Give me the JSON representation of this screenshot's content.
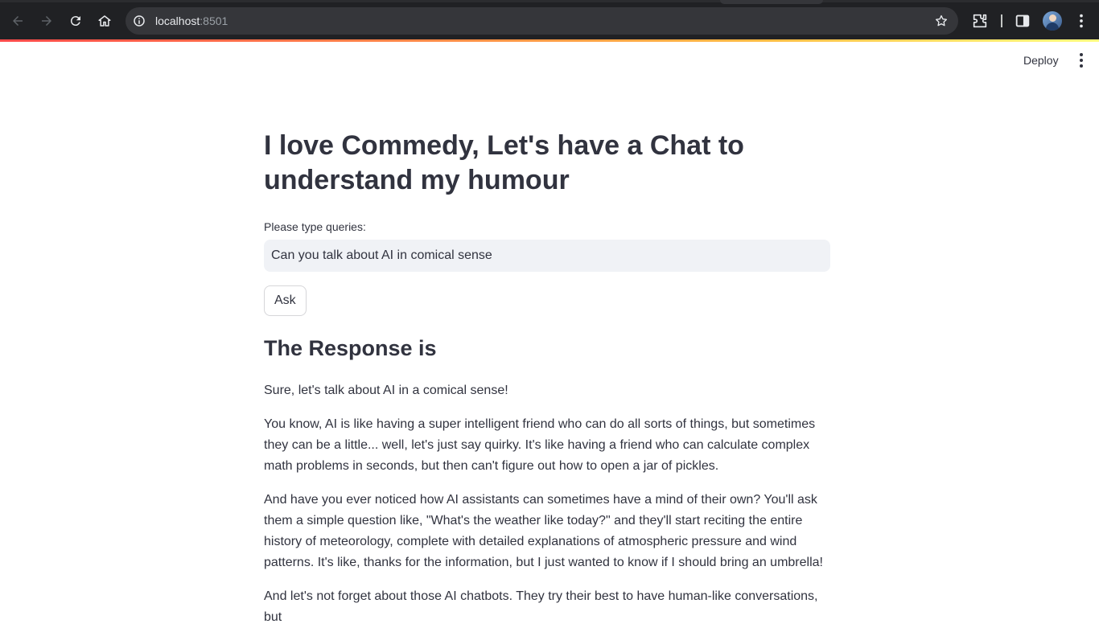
{
  "browser": {
    "url_host": "localhost",
    "url_port": ":8501"
  },
  "app_header": {
    "deploy_label": "Deploy"
  },
  "main": {
    "title": "I love Commedy, Let's have a Chat to understand my humour",
    "input_label": "Please type queries:",
    "input_value": "Can you talk about AI in comical sense",
    "ask_label": "Ask",
    "response_heading": "The Response is",
    "response_paragraphs": [
      "Sure, let's talk about AI in a comical sense!",
      "You know, AI is like having a super intelligent friend who can do all sorts of things, but sometimes they can be a little... well, let's just say quirky. It's like having a friend who can calculate complex math problems in seconds, but then can't figure out how to open a jar of pickles.",
      "And have you ever noticed how AI assistants can sometimes have a mind of their own? You'll ask them a simple question like, \"What's the weather like today?\" and they'll start reciting the entire history of meteorology, complete with detailed explanations of atmospheric pressure and wind patterns. It's like, thanks for the information, but I just wanted to know if I should bring an umbrella!",
      "And let's not forget about those AI chatbots. They try their best to have human-like conversations, but"
    ]
  },
  "colors": {
    "chrome_bg": "#202124",
    "omnibox_bg": "#35363a",
    "text": "#31333f",
    "input_bg": "#f0f2f6",
    "accent_start": "#ff4b4b",
    "accent_end": "#fffd80"
  }
}
